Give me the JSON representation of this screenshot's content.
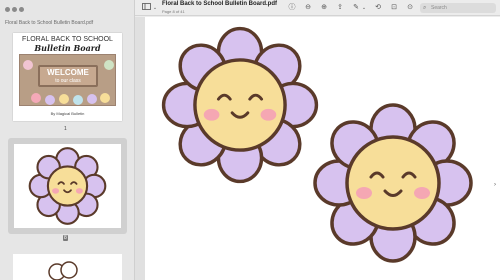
{
  "window": {
    "title": "Floral Back to School Bulletin Board.pdf",
    "page_info": "Page 8 of 41"
  },
  "sidebar": {
    "file_title": "Floral Back to School Bulletin Board.pdf",
    "thumbnails": [
      {
        "page": "1",
        "title_line1": "FLORAL BACK TO SCHOOL",
        "title_line2": "Bulletin Board",
        "welcome_line1": "WELCOME",
        "welcome_line2": "to our class",
        "credit": "By Magical Bulletin"
      },
      {
        "page": "8",
        "selected": true
      },
      {
        "page": ""
      }
    ]
  },
  "toolbar": {
    "search_placeholder": "Search",
    "icons": [
      "sidebar-icon",
      "chevron-down-icon",
      "info-icon",
      "zoom-out-icon",
      "zoom-in-icon",
      "share-icon",
      "markup-pen-icon",
      "chevron-down-icon",
      "rotate-icon",
      "crop-icon",
      "annotate-icon",
      "search-icon"
    ]
  },
  "colors": {
    "petal": "#d7c2ef",
    "outline": "#5a3a2a",
    "center": "#f7de99",
    "cheek": "#f5a7b3"
  }
}
